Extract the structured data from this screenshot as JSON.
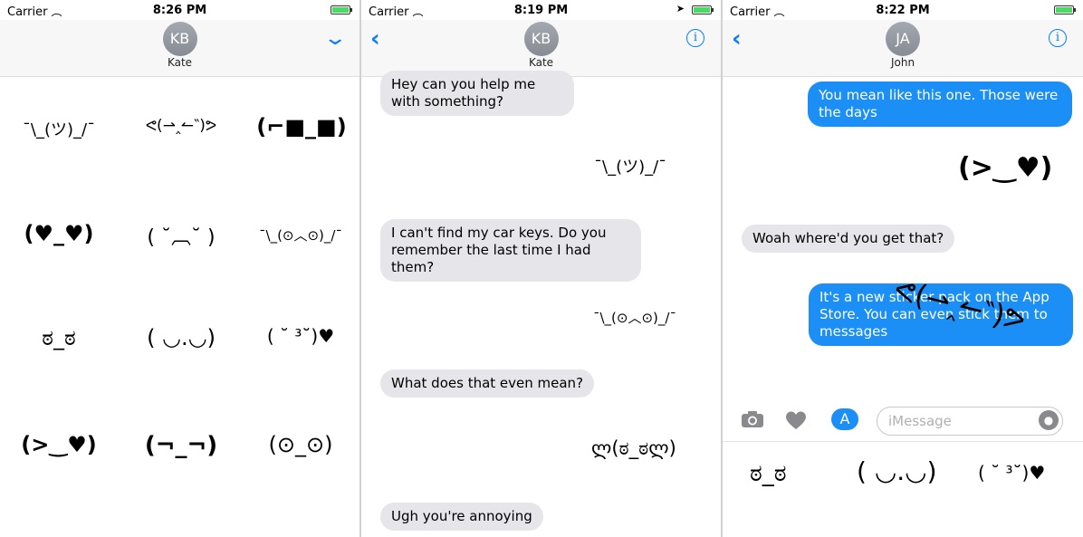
{
  "screens": [
    {
      "status": {
        "carrier": "Carrier",
        "time": "8:26 PM"
      },
      "contact": {
        "initials": "KB",
        "name": "Kate"
      },
      "stickers": [
        "¯\\_(ツ)_/¯",
        "ᕙ(⇀‸↼‶)ᕗ",
        "(⌐■_■)",
        "(♥_♥)",
        "( ˘︹˘ )",
        "¯\\_(⊙︿⊙)_/¯",
        "ಠ_ಠ",
        "( ◡.◡)",
        "( ˘ ³˘)♥",
        "(>‿♥)",
        "(¬_¬)",
        "(⊙_⊙)"
      ]
    },
    {
      "status": {
        "carrier": "Carrier",
        "time": "8:19 PM"
      },
      "contact": {
        "initials": "KB",
        "name": "Kate"
      },
      "messages": [
        {
          "type": "in",
          "text": "Hey can you help me with something?"
        },
        {
          "type": "sticker",
          "text": "¯\\_(ツ)_/¯"
        },
        {
          "type": "in",
          "text": "I can't find my car keys. Do you remember the last time I had them?"
        },
        {
          "type": "sticker",
          "text": "¯\\_(⊙︿⊙)_/¯"
        },
        {
          "type": "in",
          "text": "What does that even mean?"
        },
        {
          "type": "sticker",
          "text": "ლ(ಠ_ಠლ)"
        },
        {
          "type": "in",
          "text": "Ugh you're annoying"
        }
      ]
    },
    {
      "status": {
        "carrier": "Carrier",
        "time": "8:22 PM"
      },
      "contact": {
        "initials": "JA",
        "name": "John"
      },
      "messages": [
        {
          "type": "out",
          "text": "You mean like this one. Those were the days"
        },
        {
          "type": "sticker",
          "text": "(>‿♥)"
        },
        {
          "type": "in",
          "text": "Woah where'd you get that?"
        },
        {
          "type": "out",
          "text": "It's a new sticker pack on the App Store. You can even stick them to messages"
        },
        {
          "type": "sticker",
          "text": "ᕙ(⇀‸↼‶)ᕗ"
        }
      ],
      "input_placeholder": "iMessage",
      "drawer_stickers": [
        "ಠ_ಠ",
        "( ◡.◡)",
        "( ˘ ³˘)♥"
      ]
    }
  ]
}
